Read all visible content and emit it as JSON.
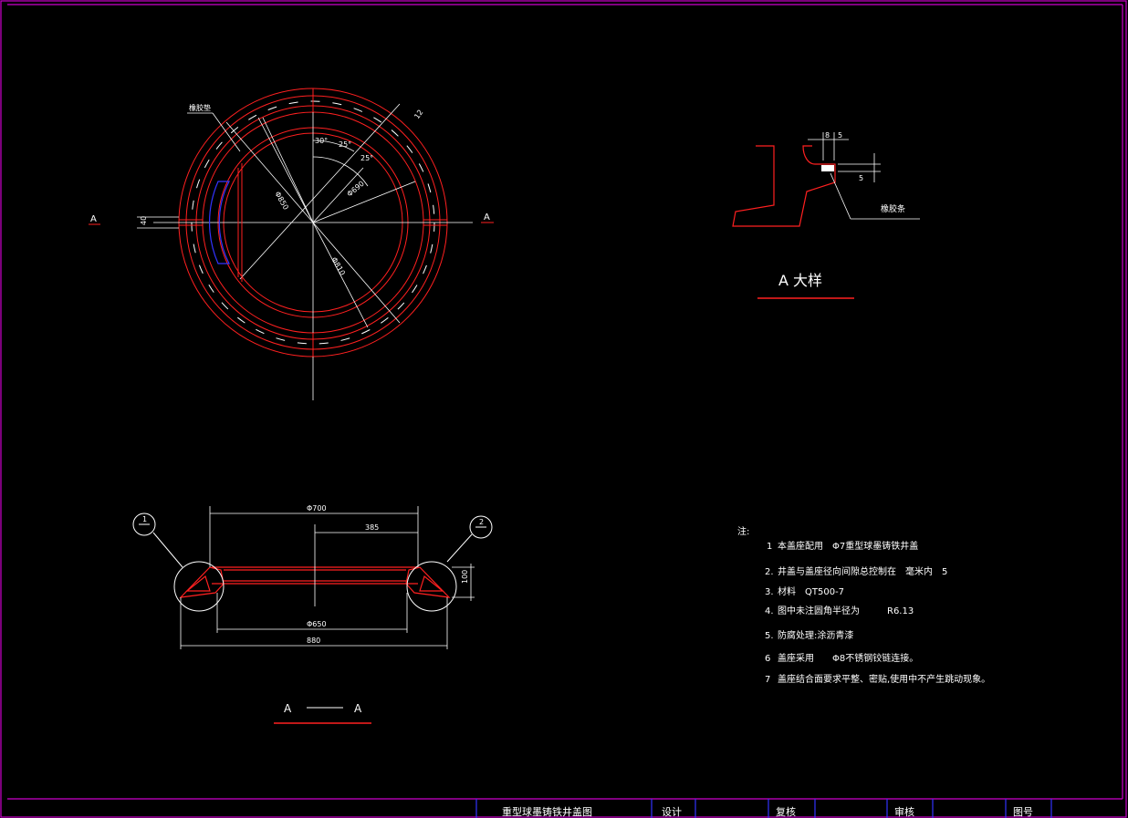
{
  "colors": {
    "background": "#000000",
    "border": "#cc00cc",
    "red": "#ff2020",
    "white": "#ffffff",
    "blue": "#3333ff"
  },
  "plan_view": {
    "section_mark_left": "A",
    "section_mark_right": "A",
    "rubber_gasket_label": "橡胶垫",
    "dim_d850": "Φ850",
    "dim_d690": "Φ690",
    "dim_d810": "Φ810",
    "angle_30": "30°",
    "angle_25a": "25°",
    "angle_25b": "25°",
    "dim_12": "12",
    "dim_40": "40"
  },
  "detail_a": {
    "title": "A 大样",
    "label": "橡胶条",
    "dim_8": "8",
    "dim_5": "5",
    "dim_side": "5"
  },
  "section_view": {
    "title_left": "A",
    "title_right": "A",
    "dim_700": "Φ700",
    "dim_385": "385",
    "dim_650": "Φ650",
    "dim_880": "880",
    "dim_100": "100",
    "callout_1": "1",
    "callout_2": "2"
  },
  "notes": {
    "heading": "注:",
    "items": [
      {
        "num": "1",
        "text": "本盖座配用　Φ7重型球墨铸铁井盖"
      },
      {
        "num": "2.",
        "text": "井盖与盖座径向间隙总控制在　毫米内　5"
      },
      {
        "num": "3.",
        "text": "材料　QT500-7"
      },
      {
        "num": "4.",
        "text": "图中未注圆角半径为　　　R6.13"
      },
      {
        "num": "5.",
        "text": "防腐处理:涂沥青漆"
      },
      {
        "num": "6",
        "text": "盖座采用　　Φ8不锈钢铰链连接。"
      },
      {
        "num": "7",
        "text": "盖座结合面要求平整、密贴,使用中不产生跳动现象。"
      }
    ]
  },
  "title_block": {
    "drawing_name": "重型球墨铸铁井盖图",
    "design_label": "设计",
    "check_label": "复核",
    "review_label": "审核",
    "drawing_no_label": "图号"
  }
}
